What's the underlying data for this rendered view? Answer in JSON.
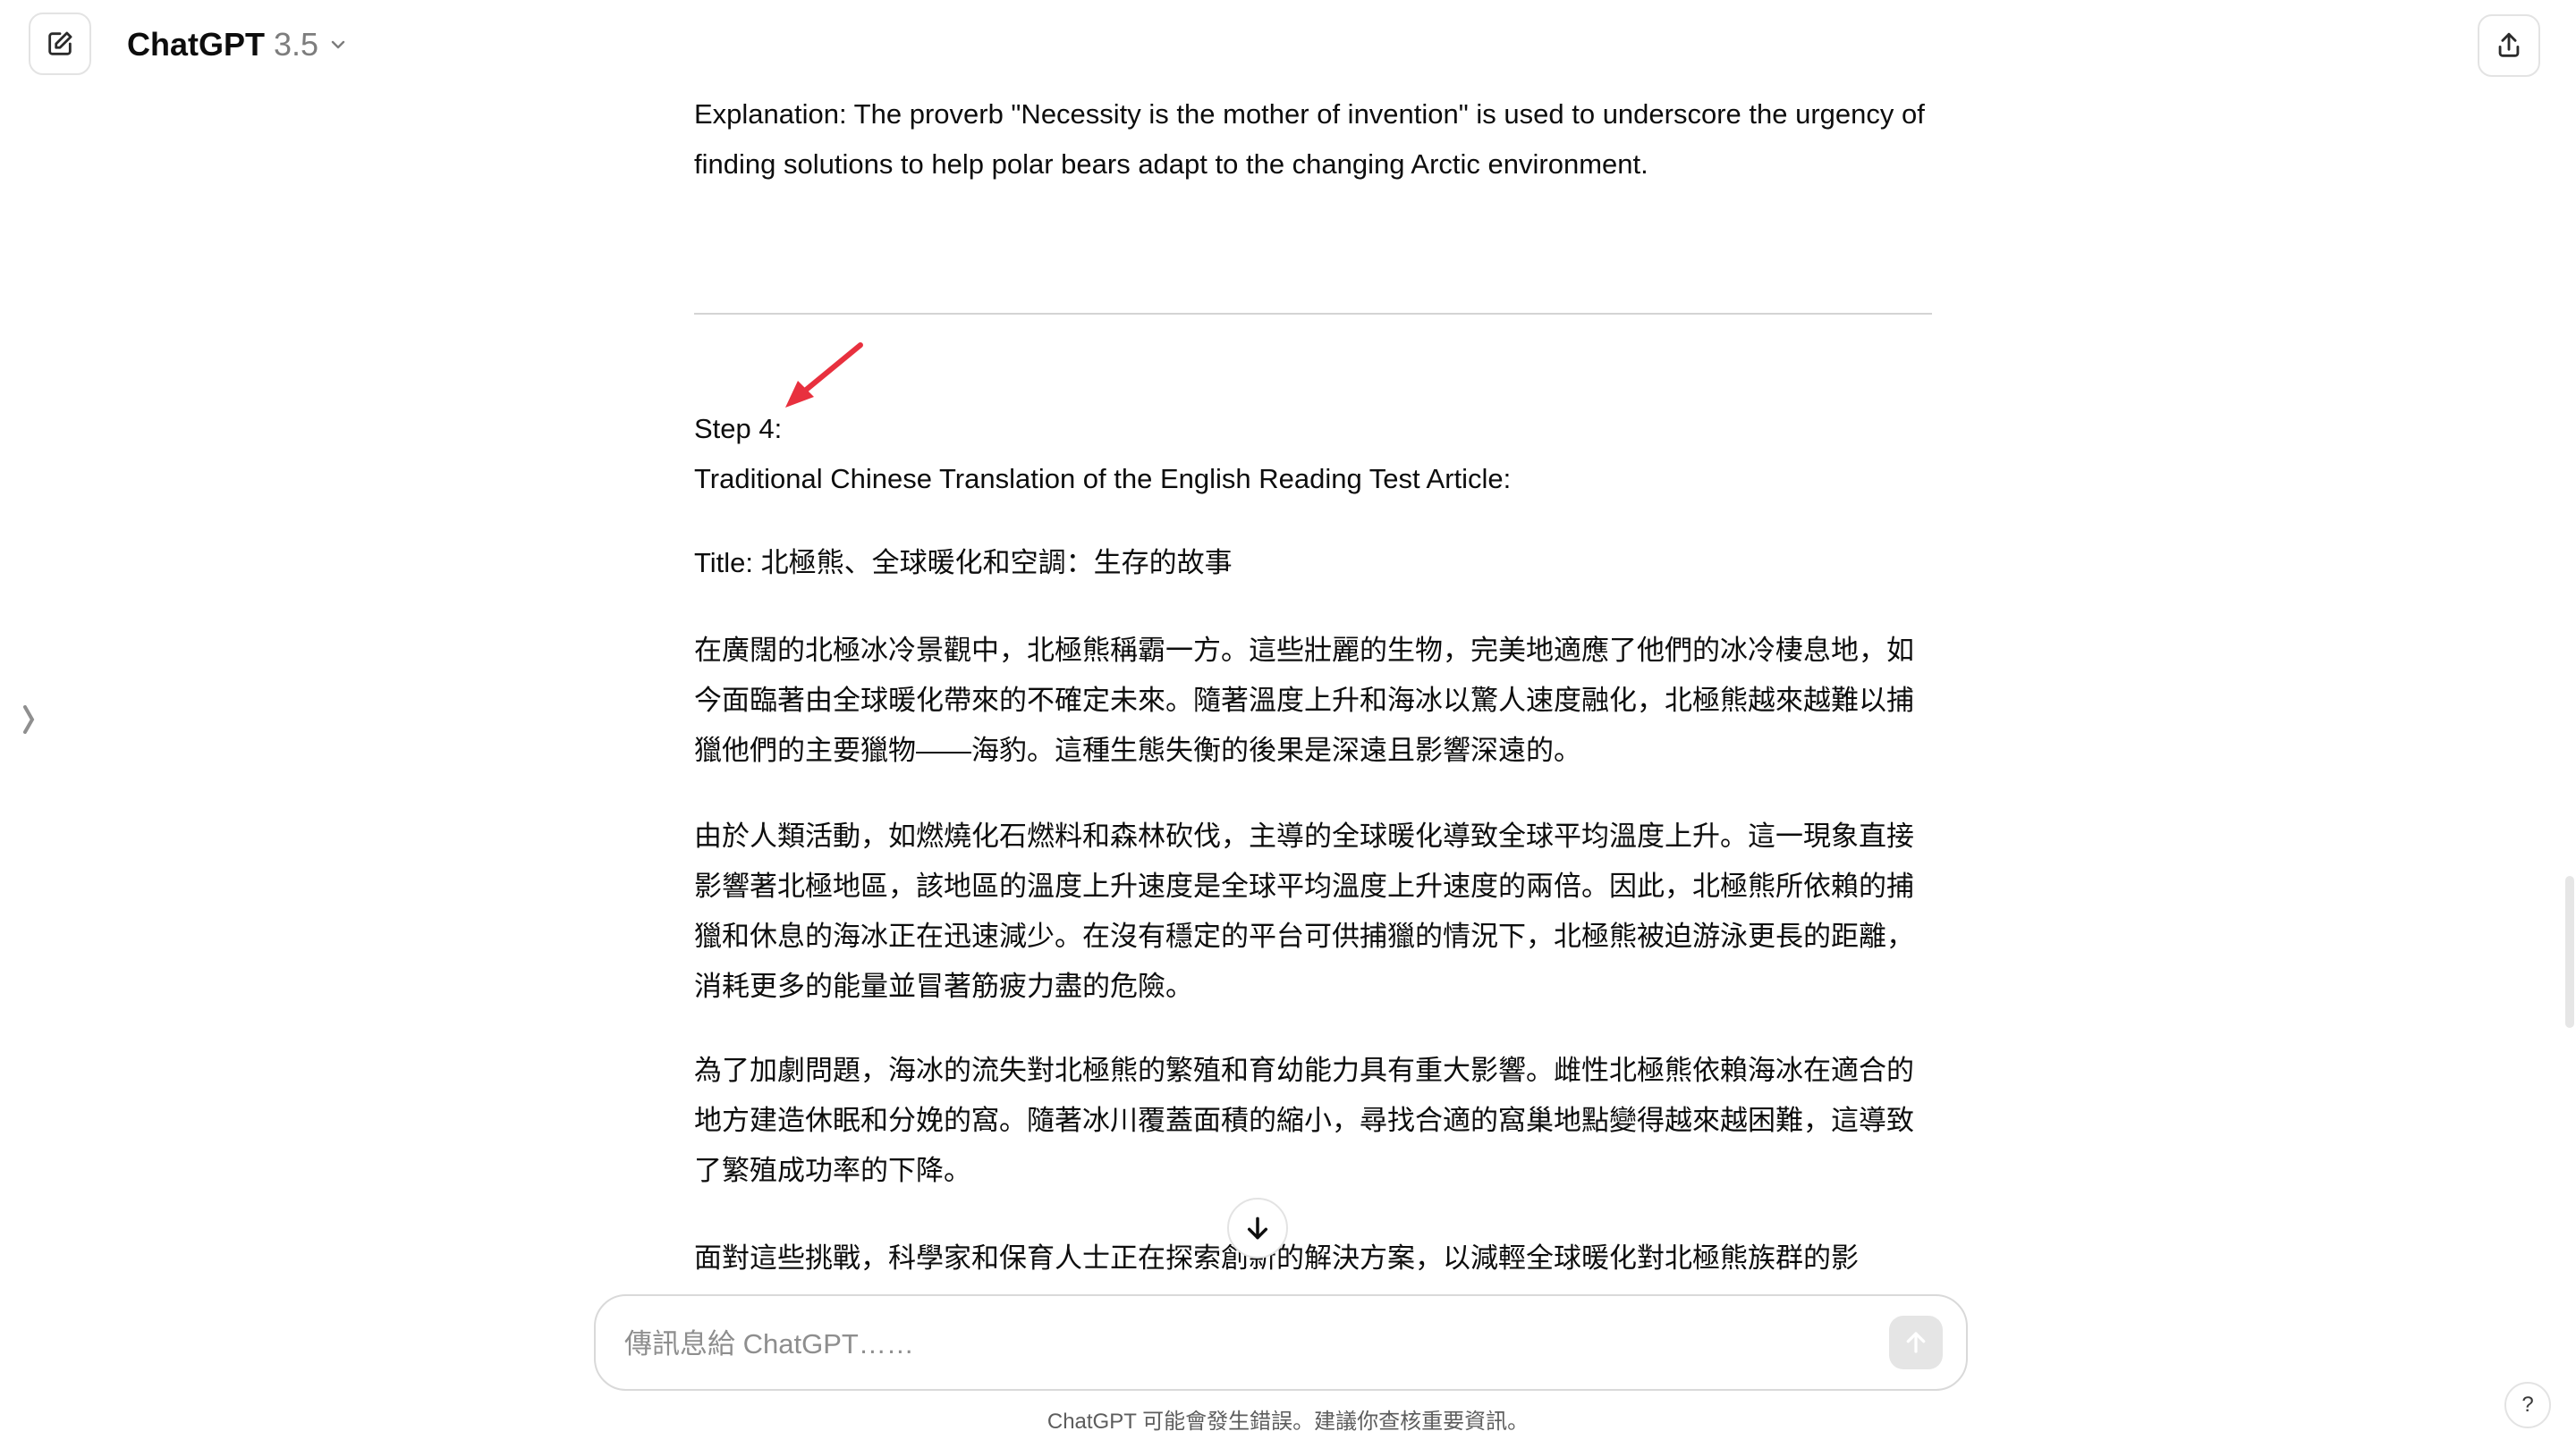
{
  "header": {
    "model_name": "ChatGPT",
    "model_version": "3.5"
  },
  "icons": {
    "edit": "edit-icon",
    "chevron": "chevron-down-icon",
    "share": "share-icon",
    "sidebar": "sidebar-toggle-icon",
    "scroll_down": "arrow-down-icon",
    "send": "arrow-up-icon"
  },
  "conversation": {
    "explanation": "Explanation: The proverb \"Necessity is the mother of invention\" is used to underscore the urgency of finding solutions to help polar bears adapt to the changing Arctic environment.",
    "step_label": "Step 4:",
    "step_subtitle": "Traditional Chinese Translation of the English Reading Test Article:",
    "title_line": "Title: 北極熊、全球暖化和空調：生存的故事",
    "paragraphs": [
      "在廣闊的北極冰冷景觀中，北極熊稱霸一方。這些壯麗的生物，完美地適應了他們的冰冷棲息地，如今面臨著由全球暖化帶來的不確定未來。隨著溫度上升和海冰以驚人速度融化，北極熊越來越難以捕獵他們的主要獵物——海豹。這種生態失衡的後果是深遠且影響深遠的。",
      "由於人類活動，如燃燒化石燃料和森林砍伐，主導的全球暖化導致全球平均溫度上升。這一現象直接影響著北極地區，該地區的溫度上升速度是全球平均溫度上升速度的兩倍。因此，北極熊所依賴的捕獵和休息的海冰正在迅速減少。在沒有穩定的平台可供捕獵的情況下，北極熊被迫游泳更長的距離，消耗更多的能量並冒著筋疲力盡的危險。",
      "為了加劇問題，海冰的流失對北極熊的繁殖和育幼能力具有重大影響。雌性北極熊依賴海冰在適合的地方建造休眠和分娩的窩。隨著冰川覆蓋面積的縮小，尋找合適的窩巢地點變得越來越困難，這導致了繁殖成功率的下降。",
      "面對這些挑戰，科學家和保育人士正在探索創新的解決方案，以減輕全球暖化對北極熊族群的影"
    ]
  },
  "composer": {
    "placeholder": "傳訊息給 ChatGPT……"
  },
  "footer": {
    "disclaimer": "ChatGPT 可能會發生錯誤。建議你查核重要資訊。",
    "help_label": "?"
  },
  "colors": {
    "annotation_arrow": "#e8303e",
    "divider": "#d4d4d4"
  }
}
